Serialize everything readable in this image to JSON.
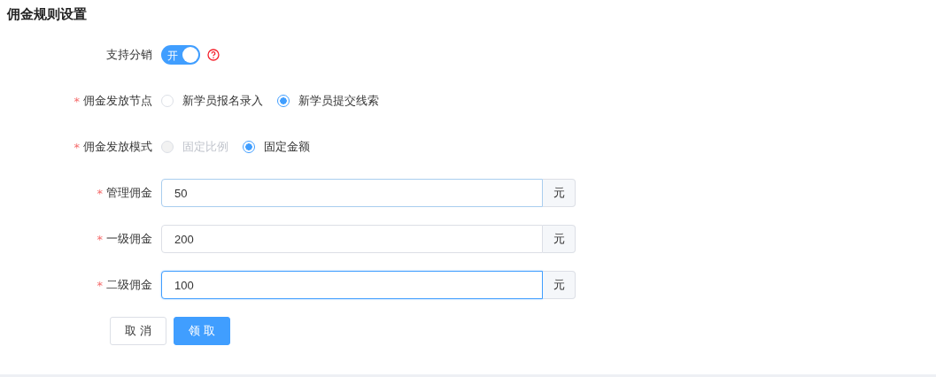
{
  "title": "佣金规则设置",
  "distribution": {
    "label": "支持分销",
    "on": true,
    "switch_text": "开"
  },
  "payout_node": {
    "mark": "*",
    "label": "佣金发放节点",
    "options": [
      {
        "label": "新学员报名录入",
        "selected": false,
        "disabled": false
      },
      {
        "label": "新学员提交线索",
        "selected": true,
        "disabled": false
      }
    ]
  },
  "payout_mode": {
    "mark": "*",
    "label": "佣金发放模式",
    "options": [
      {
        "label": "固定比例",
        "selected": false,
        "disabled": true
      },
      {
        "label": "固定金额",
        "selected": true,
        "disabled": false
      }
    ]
  },
  "fields": [
    {
      "mark": "*",
      "label": "管理佣金",
      "value": "50",
      "unit": "元",
      "hovered": true,
      "focused": false
    },
    {
      "mark": "*",
      "label": "一级佣金",
      "value": "200",
      "unit": "元",
      "hovered": false,
      "focused": false
    },
    {
      "mark": "*",
      "label": "二级佣金",
      "value": "100",
      "unit": "元",
      "hovered": false,
      "focused": true
    }
  ],
  "buttons": [
    {
      "label": "取 消",
      "kind": "default"
    },
    {
      "label": "领 取",
      "kind": "primary"
    }
  ]
}
